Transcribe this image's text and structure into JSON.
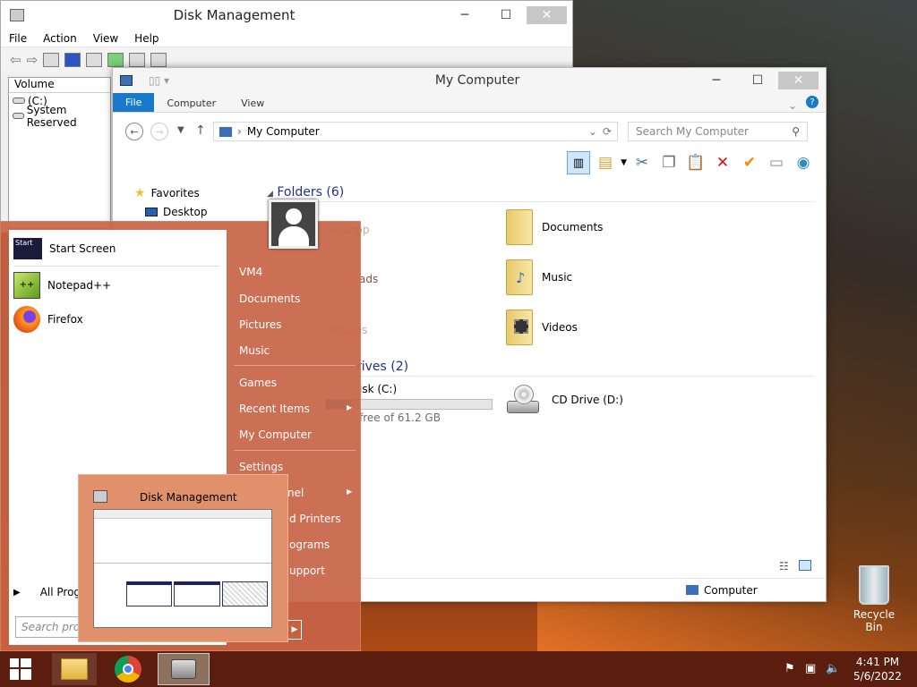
{
  "disk_mgmt": {
    "title": "Disk Management",
    "menu": [
      "File",
      "Action",
      "View",
      "Help"
    ],
    "list_header": "Volume",
    "volumes": [
      "(C:)",
      "System Reserved"
    ]
  },
  "explorer": {
    "title": "My Computer",
    "ribbon_tabs": [
      "File",
      "Computer",
      "View"
    ],
    "address": "My Computer",
    "search_placeholder": "Search My Computer",
    "nav": {
      "favorites": "Favorites",
      "desktop": "Desktop"
    },
    "folders_header": "Folders (6)",
    "folders": [
      "Documents",
      "Music",
      "Videos"
    ],
    "drives_header": "rives (2)",
    "drive_c": {
      "label": "isk (C:)",
      "free_text": "free of 61.2 GB",
      "used_fraction": 0.15
    },
    "drive_d": "CD Drive (D:)",
    "hidden_labels": [
      "Desktop",
      "ads",
      "Pictures"
    ],
    "status_text": "Computer"
  },
  "start_menu": {
    "pinned": [
      "Start Screen",
      "Notepad++",
      "Firefox"
    ],
    "all_programs": "All Prog",
    "search_placeholder": "Search prog",
    "right_links": [
      "VM4",
      "Documents",
      "Pictures",
      "Music",
      "Games",
      "Recent Items",
      "My Computer",
      "Settings",
      "nel",
      "d Printers",
      "ograms",
      "upport"
    ],
    "start_icon_text": "Start"
  },
  "thumbnail": {
    "title": "Disk Management"
  },
  "desktop": {
    "recycle_bin": "Recycle Bin"
  },
  "taskbar": {
    "time": "4:41 PM",
    "date": "5/6/2022"
  },
  "colors": {
    "accent": "#1979ca",
    "start_menu": "#c8644a",
    "taskbar": "#5a1d0e",
    "folder_header": "#1e3287"
  }
}
